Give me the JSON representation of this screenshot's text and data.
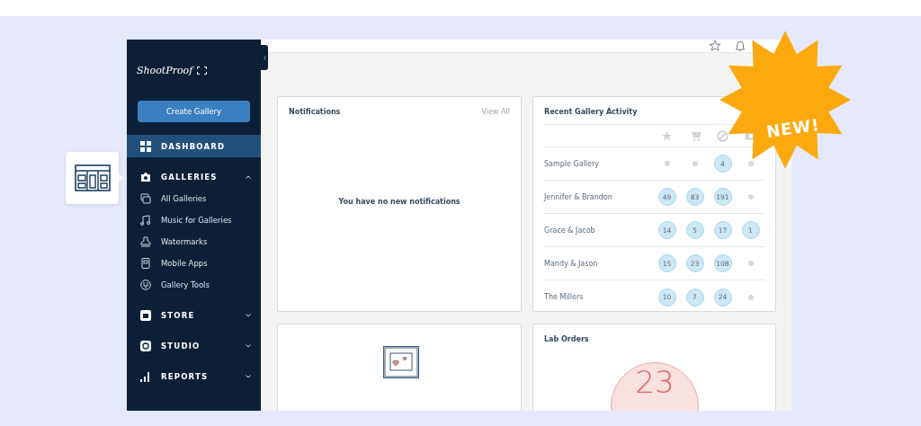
{
  "sidebar": {
    "logo": "ShootProof",
    "create_button": "Create Gallery",
    "items": [
      {
        "label": "DASHBOARD",
        "selected": true
      },
      {
        "label": "GALLERIES",
        "selected": false,
        "expanded": true,
        "children": [
          {
            "label": "All Galleries"
          },
          {
            "label": "Music for Galleries"
          },
          {
            "label": "Watermarks"
          },
          {
            "label": "Mobile Apps"
          },
          {
            "label": "Gallery Tools"
          }
        ]
      },
      {
        "label": "STORE",
        "selected": false,
        "expanded": false
      },
      {
        "label": "STUDIO",
        "selected": false,
        "expanded": false
      },
      {
        "label": "REPORTS",
        "selected": false,
        "expanded": false
      }
    ]
  },
  "notifications": {
    "title": "Notifications",
    "link": "View All",
    "empty_text": "You have no new notifications"
  },
  "activity": {
    "title": "Recent Gallery Activity",
    "rows": [
      {
        "name": "Sample Gallery",
        "cells": [
          {
            "kind": "empty"
          },
          {
            "kind": "empty"
          },
          {
            "kind": "count",
            "value": "4"
          },
          {
            "kind": "empty"
          }
        ]
      },
      {
        "name": "Jennifer & Brandon",
        "cells": [
          {
            "kind": "count",
            "value": "49"
          },
          {
            "kind": "count",
            "value": "83"
          },
          {
            "kind": "count",
            "value": "191"
          },
          {
            "kind": "empty"
          }
        ]
      },
      {
        "name": "Grace & Jacob",
        "cells": [
          {
            "kind": "count",
            "value": "14"
          },
          {
            "kind": "count",
            "value": "5"
          },
          {
            "kind": "count",
            "value": "17"
          },
          {
            "kind": "count",
            "value": "1"
          }
        ]
      },
      {
        "name": "Mandy & Jason",
        "cells": [
          {
            "kind": "count",
            "value": "15"
          },
          {
            "kind": "count",
            "value": "23"
          },
          {
            "kind": "count",
            "value": "108"
          },
          {
            "kind": "empty"
          }
        ]
      },
      {
        "name": "The Millers",
        "cells": [
          {
            "kind": "count",
            "value": "10"
          },
          {
            "kind": "count",
            "value": "7"
          },
          {
            "kind": "count",
            "value": "24"
          },
          {
            "kind": "empty"
          }
        ]
      }
    ]
  },
  "lab_orders": {
    "title": "Lab Orders",
    "count": "23"
  },
  "badge": "NEW!"
}
